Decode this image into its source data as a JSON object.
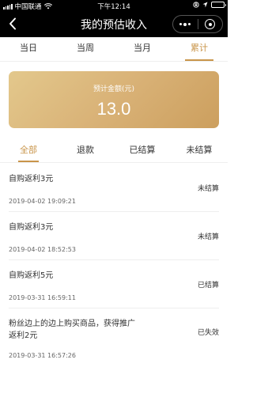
{
  "status_bar": {
    "carrier": "中国联通",
    "time": "下午12:14"
  },
  "nav": {
    "title": "我的预估收入"
  },
  "period_tabs": [
    {
      "label": "当日",
      "active": false
    },
    {
      "label": "当周",
      "active": false
    },
    {
      "label": "当月",
      "active": false
    },
    {
      "label": "累计",
      "active": true
    }
  ],
  "summary": {
    "label": "预计金额(元)",
    "amount": "13.0"
  },
  "status_tabs": [
    {
      "label": "全部",
      "active": true
    },
    {
      "label": "退款",
      "active": false
    },
    {
      "label": "已结算",
      "active": false
    },
    {
      "label": "未结算",
      "active": false
    }
  ],
  "records": [
    {
      "title": "自购返利3元",
      "time": "2019-04-02 19:09:21",
      "status": "未结算"
    },
    {
      "title": "自购返利3元",
      "time": "2019-04-02 18:52:53",
      "status": "未结算"
    },
    {
      "title": "自购返利5元",
      "time": "2019-03-31 16:59:11",
      "status": "已结算"
    },
    {
      "title": "粉丝边上的边上购买商品，获得推广返利2元",
      "time": "2019-03-31 16:57:26",
      "status": "已失效"
    }
  ],
  "colors": {
    "accent": "#c9954a",
    "card_gradient_start": "#e3c88c",
    "card_gradient_end": "#cc9f5e",
    "header_bg": "#000000"
  }
}
